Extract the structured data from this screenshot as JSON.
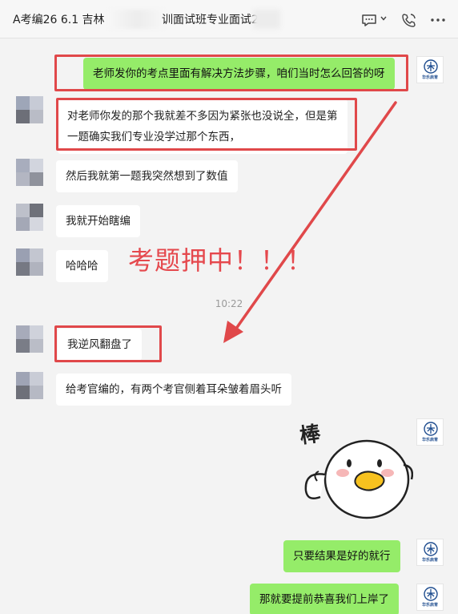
{
  "window": {
    "title_left": "A考编26 6.1 吉林",
    "title_right": "训面试班专业面试2",
    "icons": [
      "chat-bubble-icon",
      "chevron-down-icon",
      "call-icon",
      "more-icon"
    ]
  },
  "messages": [
    {
      "side": "right",
      "text": "老师发你的考点里面有解决方法步骤，咱们当时怎么回答的呀"
    },
    {
      "side": "left",
      "line1": "对老师你发的那个我就差不多因为紧张也没说全，但是第",
      "line2": "一题确实我们专业没学过那个东西，"
    },
    {
      "side": "left",
      "text": "然后我就第一题我突然想到了数值"
    },
    {
      "side": "left",
      "text": "我就开始瞎编"
    },
    {
      "side": "left",
      "text": "哈哈哈"
    },
    {
      "side": "left",
      "text": "我逆风翻盘了"
    },
    {
      "side": "left",
      "text": "给考官编的，有两个考官侧着耳朵皱着眉头听"
    },
    {
      "side": "right",
      "text": "只要结果是好的就行"
    },
    {
      "side": "right",
      "text": "那就要提前恭喜我们上岸了"
    }
  ],
  "timestamp": "10:22",
  "annotation": "考题押中！！！",
  "sticker": {
    "caption": "棒"
  },
  "logo": {
    "text": "华乐启育"
  },
  "colors": {
    "right_bubble": "#95ec69",
    "left_bubble": "#ffffff",
    "highlight": "#e0484a"
  }
}
